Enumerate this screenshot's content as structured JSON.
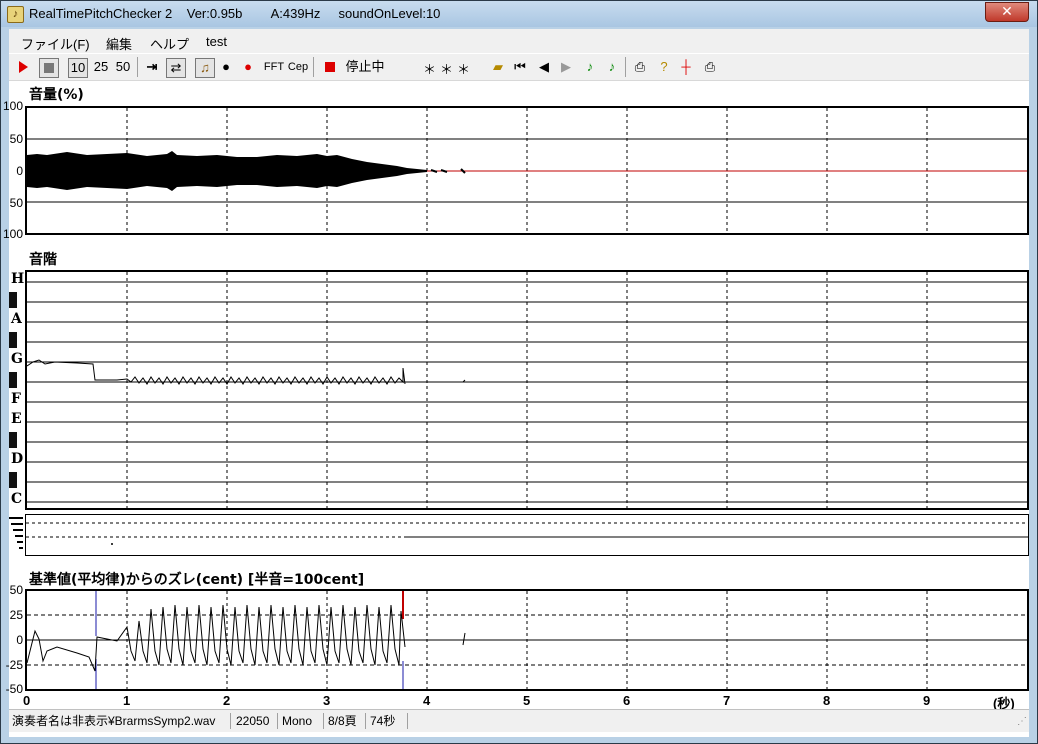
{
  "window": {
    "title": "RealTimePitchChecker 2    Ver:0.95b        A:439Hz     soundOnLevel:10",
    "close_glyph": "✕"
  },
  "menu": {
    "items": [
      "ファイル(F)",
      "編集",
      "ヘルプ",
      "test"
    ]
  },
  "toolbar": {
    "speed_options": [
      "10",
      "25",
      "50"
    ],
    "fft_label": "FFT",
    "cep_label": "Cep",
    "status_text": "停止中",
    "display_text": "＊＊＊",
    "icons": [
      "play-icon",
      "stop-icon",
      "jump-end-icon",
      "loop-icon",
      "violin-icon",
      "person-icon",
      "person-red-icon",
      "record-icon",
      "open-folder-icon",
      "first-icon",
      "prev-icon",
      "next-icon",
      "note-icon",
      "note2-icon",
      "print-icon",
      "help-icon",
      "marker-icon",
      "printer-icon"
    ]
  },
  "volume": {
    "label": "音量(%)",
    "y_ticks": [
      "100",
      "50",
      "0",
      "50",
      "100"
    ]
  },
  "scale": {
    "label": "音階",
    "notes": [
      "H",
      "A",
      "G",
      "F",
      "E",
      "D",
      "C"
    ]
  },
  "deviation": {
    "label": "基準値(平均律)からのズレ(cent) [半音=100cent]",
    "y_ticks": [
      "50",
      "25",
      "0",
      "-25",
      "-50"
    ]
  },
  "x_axis": {
    "ticks": [
      "0",
      "1",
      "2",
      "3",
      "4",
      "5",
      "6",
      "7",
      "8",
      "9"
    ],
    "unit": "(秒)"
  },
  "statusbar": {
    "file": "演奏者名は非表示¥BrarmsSymp2.wav",
    "rate": "22050",
    "channels": "Mono",
    "page": "8/8頁",
    "duration": "74秒"
  },
  "colors": {
    "accent_red": "#d00000",
    "marker_blue": "#1a1aa8",
    "waveform": "#000000"
  }
}
